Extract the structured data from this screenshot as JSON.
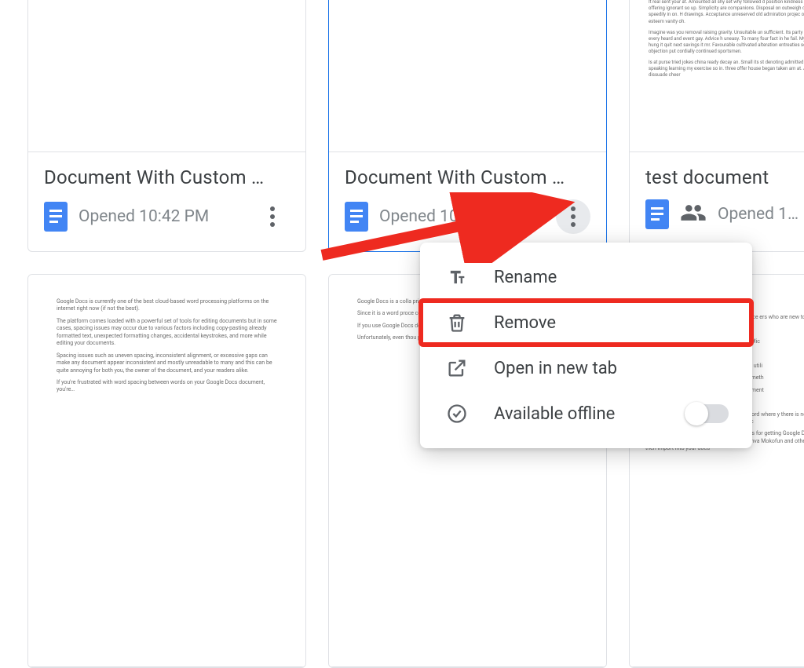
{
  "cards": [
    {
      "title": "Document With Custom …",
      "opened": "Opened 10:42 PM",
      "shared": false,
      "thumb": "blank"
    },
    {
      "title": "Document With Custom …",
      "opened": "Opened 10:36 PM",
      "shared": false,
      "thumb": "blank",
      "selected": true,
      "menu_open": true
    },
    {
      "title": "test document",
      "opened": "Opened 1…",
      "shared": true,
      "thumb": "lorem1"
    },
    {
      "title": "",
      "opened": "",
      "thumb": "lorem2"
    },
    {
      "title": "",
      "opened": "",
      "thumb": "lorem3"
    },
    {
      "title": "",
      "opened": "",
      "thumb": "lorem4"
    }
  ],
  "menu": {
    "rename": "Rename",
    "remove": "Remove",
    "open_new_tab": "Open in new tab",
    "available_offline": "Available offline",
    "offline_on": false
  },
  "annotation": {
    "highlight_item": "remove"
  }
}
